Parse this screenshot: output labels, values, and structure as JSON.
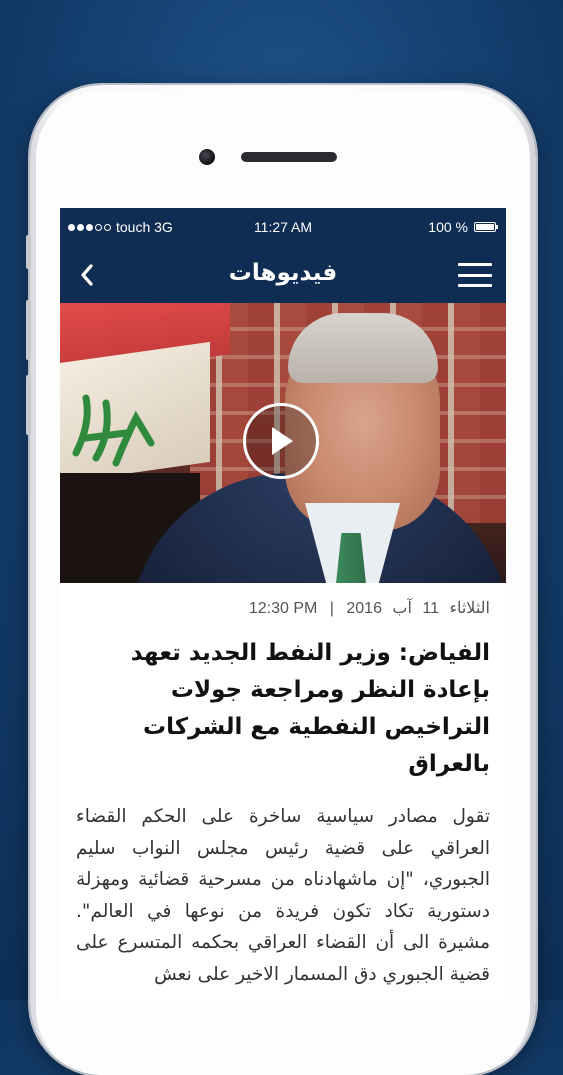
{
  "status_bar": {
    "carrier": "touch 3G",
    "time": "11:27 AM",
    "battery": "100 %",
    "signal_bars_filled": 3,
    "signal_bars_total": 5
  },
  "nav": {
    "title": "فيديوهات",
    "back_icon": "chevron-left-icon",
    "menu_icon": "hamburger-menu-icon"
  },
  "video": {
    "play_icon": "play-icon"
  },
  "article": {
    "date_day": "الثلاثاء",
    "date_num": "11",
    "date_month": "آب",
    "date_year": "2016",
    "separator": "|",
    "time": "12:30 PM",
    "title": "الفياض: وزير النفط الجديد تعهد بإعادة النظر ومراجعة جولات التراخيص النفطية مع الشركات بالعراق",
    "body": "تقول مصادر سياسية ساخرة على الحكم القضاء العراقي على قضية رئيس مجلس النواب سليم الجبوري، \"إن ماشهادناه من مسرحية قضائية ومهزلة دستورية تكاد تكون فريدة من نوعها في العالم\". مشيرة الى أن القضاء العراقي بحكمه المتسرع على قضية الجبوري دق المسمار الاخير على نعش"
  },
  "colors": {
    "navbar": "#0f2d52",
    "background": "#174577"
  }
}
